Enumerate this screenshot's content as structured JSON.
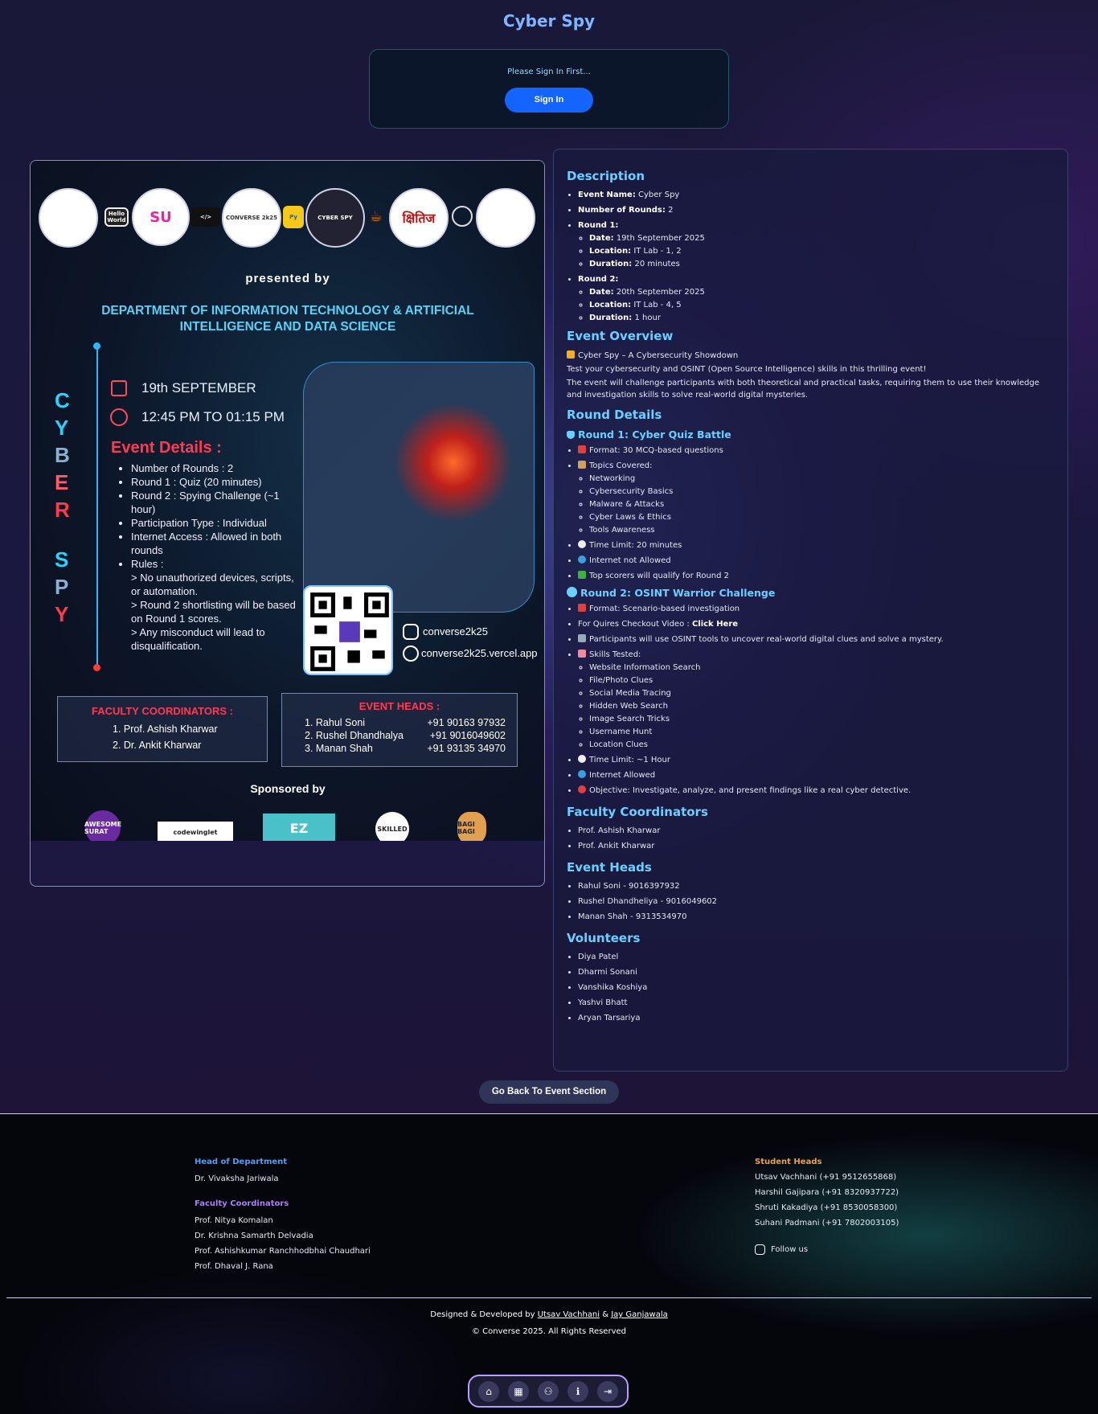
{
  "page": {
    "title": "Cyber Spy"
  },
  "signin": {
    "message": "Please Sign In First...",
    "button": "Sign In"
  },
  "poster": {
    "presented_by": "presented by",
    "department": "DEPARTMENT OF INFORMATION TECHNOLOGY & ARTIFICIAL INTELLIGENCE AND DATA SCIENCE",
    "vertical_title": [
      "C",
      "Y",
      "B",
      "E",
      "R",
      "S",
      "P",
      "Y"
    ],
    "date": "19th SEPTEMBER",
    "time": "12:45 PM TO 01:15 PM",
    "event_details_title": "Event Details :",
    "event_details": [
      "Number of Rounds : 2",
      "Round 1 : Quiz (20 minutes)",
      "Round 2 : Spying Challenge (~1 hour)",
      "Participation Type : Individual",
      "Internet Access : Allowed in both rounds",
      "Rules :"
    ],
    "rules": [
      "> No unauthorized devices, scripts, or automation.",
      "> Round 2 shortlisting will be based on Round 1 scores.",
      "> Any misconduct will lead to disqualification."
    ],
    "instagram": "converse2k25",
    "website": "converse2k25.vercel.app",
    "faculty_title": "FACULTY COORDINATORS :",
    "faculty": [
      "1. Prof. Ashish Kharwar",
      "2. Dr. Ankit Kharwar"
    ],
    "heads_title": "EVENT HEADS :",
    "heads": [
      {
        "name": "1. Rahul Soni",
        "phone": "+91 90163 97932"
      },
      {
        "name": "2. Rushel Dhandhalya",
        "phone": "+91 9016049602"
      },
      {
        "name": "3. Manan Shah",
        "phone": "+91 93135 34970"
      }
    ],
    "sponsored_by": "Sponsored by",
    "logos": [
      "Hello World",
      "CONVERSE 2k25",
      "CYBER SPY",
      "क्षितिज"
    ],
    "sponsors": [
      "AWESOME SURAT",
      "codewinglet",
      "EZ",
      "SKILLED",
      "BAGI BAGI"
    ]
  },
  "details": {
    "description_title": "Description",
    "event_name_label": "Event Name:",
    "event_name": "Cyber Spy",
    "rounds_label": "Number of Rounds:",
    "rounds": "2",
    "round1_label": "Round 1:",
    "round2_label": "Round 2:",
    "date_label": "Date:",
    "location_label": "Location:",
    "duration_label": "Duration:",
    "r1_date": "19th September 2025",
    "r1_location": "IT Lab - 1, 2",
    "r1_duration": "20 minutes",
    "r2_date": "20th September 2025",
    "r2_location": "IT Lab - 4, 5",
    "r2_duration": "1 hour",
    "overview_title": "Event Overview",
    "overview_tag": "Cyber Spy – A Cybersecurity Showdown",
    "overview_p1": "Test your cybersecurity and OSINT (Open Source Intelligence) skills in this thrilling event!",
    "overview_p2": "The event will challenge participants with both theoretical and practical tasks, requiring them to use their knowledge and investigation skills to solve real-world digital mysteries.",
    "round_details_title": "Round Details",
    "r1_title": "Round 1: Cyber Quiz Battle",
    "r1_format": "Format: 30 MCQ-based questions",
    "r1_topics_label": "Topics Covered:",
    "r1_topics": [
      "Networking",
      "Cybersecurity Basics",
      "Malware & Attacks",
      "Cyber Laws & Ethics",
      "Tools Awareness"
    ],
    "r1_time": "Time Limit: 20 minutes",
    "r1_internet": "Internet not Allowed",
    "r1_qualify": "Top scorers will qualify for Round 2",
    "r2_title": "Round 2: OSINT Warrior Challenge",
    "r2_format": "Format: Scenario-based investigation",
    "r2_video_text": "For Quires Checkout Video :",
    "r2_video_link": "Click Here",
    "r2_participants": "Participants will use OSINT tools to uncover real-world digital clues and solve a mystery.",
    "r2_skills_label": "Skills Tested:",
    "r2_skills": [
      "Website Information Search",
      "File/Photo Clues",
      "Social Media Tracing",
      "Hidden Web Search",
      "Image Search Tricks",
      "Username Hunt",
      "Location Clues"
    ],
    "r2_time": "Time Limit: ~1 Hour",
    "r2_internet": "Internet Allowed",
    "r2_objective": "Objective: Investigate, analyze, and present findings like a real cyber detective.",
    "faculty_title": "Faculty Coordinators",
    "faculty": [
      "Prof. Ashish Kharwar",
      "Prof. Ankit Kharwar"
    ],
    "heads_title": "Event Heads",
    "heads": [
      "Rahul Soni - 9016397932",
      "Rushel Dhandheliya - 9016049602",
      "Manan Shah - 9313534970"
    ],
    "volunteers_title": "Volunteers",
    "volunteers": [
      "Diya Patel",
      "Dharmi Sonani",
      "Vanshika Koshiya",
      "Yashvi Bhatt",
      "Aryan Tarsariya"
    ]
  },
  "back_button": "Go Back To Event Section",
  "footer": {
    "hod_title": "Head of Department",
    "hod": "Dr. Vivaksha Jariwala",
    "fc_title": "Faculty Coordinators",
    "fc": [
      "Prof. Nitya Komalan",
      "Dr. Krishna Samarth Delvadia",
      "Prof. Ashishkumar Ranchhodbhai Chaudhari",
      "Prof. Dhaval J. Rana"
    ],
    "sh_title": "Student Heads",
    "sh": [
      "Utsav Vachhani (+91 9512655868)",
      "Harshil Gajipara (+91 8320937722)",
      "Shruti Kakadiya (+91 8530058300)",
      "Suhani Padmani (+91 7802003105)"
    ],
    "follow": "Follow us",
    "designed_prefix": "Designed & Developed by",
    "dev1": "Utsav Vachhani",
    "amp": "&",
    "dev2": "Jay Ganjawala",
    "copyright": "© Converse 2025. All Rights Reserved"
  },
  "colors": {
    "accent": "#69d0ff",
    "signin": "#1464ff",
    "hod_title": "#4aa0ff",
    "fc_title": "#b07cff",
    "sh_title": "#f0a040"
  },
  "dock": {
    "icons": [
      "home-icon",
      "calendar-icon",
      "people-icon",
      "info-icon",
      "login-icon"
    ]
  }
}
